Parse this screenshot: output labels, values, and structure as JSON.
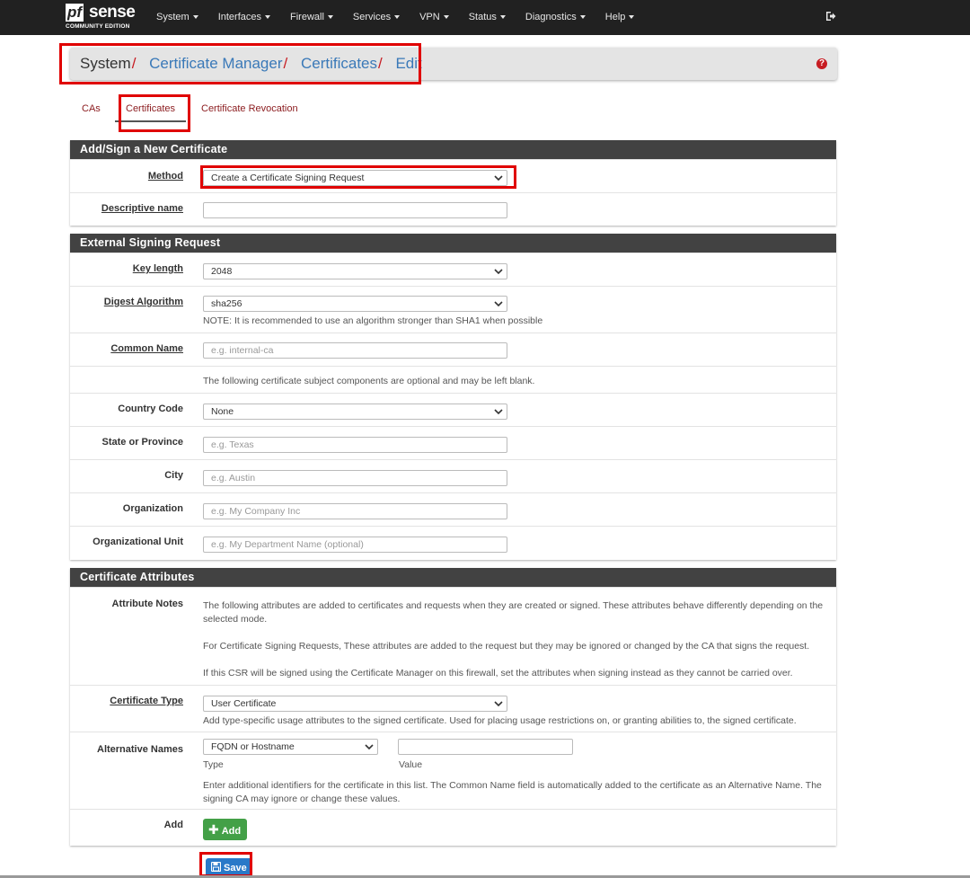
{
  "nav": {
    "logo_pf": "pf",
    "logo_sense": "sense",
    "logo_edition": "COMMUNITY EDITION",
    "items": [
      "System",
      "Interfaces",
      "Firewall",
      "Services",
      "VPN",
      "Status",
      "Diagnostics",
      "Help"
    ],
    "logout_icon": "sign-out-icon"
  },
  "breadcrumb": {
    "root": "System",
    "links": [
      "Certificate Manager",
      "Certificates",
      "Edit"
    ],
    "separator": "/",
    "help_icon": "question-circle-icon"
  },
  "tabs": [
    "CAs",
    "Certificates",
    "Certificate Revocation"
  ],
  "active_tab": "Certificates",
  "panel_add": {
    "title": "Add/Sign a New Certificate",
    "method_label": "Method",
    "method_value": "Create a Certificate Signing Request",
    "descr_label": "Descriptive name",
    "descr_value": ""
  },
  "panel_csr": {
    "title": "External Signing Request",
    "key_length_label": "Key length",
    "key_length_value": "2048",
    "digest_label": "Digest Algorithm",
    "digest_value": "sha256",
    "digest_note": "NOTE: It is recommended to use an algorithm stronger than SHA1 when possible",
    "cn_label": "Common Name",
    "cn_placeholder": "e.g. internal-ca",
    "optional_note": "The following certificate subject components are optional and may be left blank.",
    "country_label": "Country Code",
    "country_value": "None",
    "state_label": "State or Province",
    "state_placeholder": "e.g. Texas",
    "city_label": "City",
    "city_placeholder": "e.g. Austin",
    "org_label": "Organization",
    "org_placeholder": "e.g. My Company Inc",
    "ou_label": "Organizational Unit",
    "ou_placeholder": "e.g. My Department Name (optional)"
  },
  "panel_attr": {
    "title": "Certificate Attributes",
    "notes_label": "Attribute Notes",
    "notes_p1": "The following attributes are added to certificates and requests when they are created or signed. These attributes behave differently depending on the selected mode.",
    "notes_p2": "For Certificate Signing Requests, These attributes are added to the request but they may be ignored or changed by the CA that signs the request.",
    "notes_p3": "If this CSR will be signed using the Certificate Manager on this firewall, set the attributes when signing instead as they cannot be carried over.",
    "cert_type_label": "Certificate Type",
    "cert_type_value": "User Certificate",
    "cert_type_help": "Add type-specific usage attributes to the signed certificate. Used for placing usage restrictions on, or granting abilities to, the signed certificate.",
    "alt_label": "Alternative Names",
    "alt_type_value": "FQDN or Hostname",
    "alt_value": "",
    "alt_type_caption": "Type",
    "alt_value_caption": "Value",
    "alt_help": "Enter additional identifiers for the certificate in this list. The Common Name field is automatically added to the certificate as an Alternative Name. The signing CA may ignore or change these values.",
    "add_label": "Add",
    "add_button": "Add"
  },
  "save_button": "Save",
  "colors": {
    "navbar": "#212121",
    "panel_header": "#424242",
    "link": "#3a79b8",
    "tab_link": "#8b1b1e",
    "add_green": "#43a047",
    "save_blue": "#2979c8",
    "highlight": "#e00000"
  }
}
